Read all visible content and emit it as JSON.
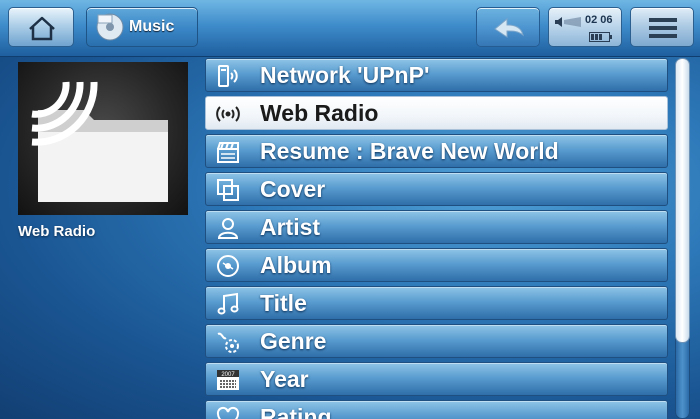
{
  "topbar": {
    "title": "Music",
    "time": "02 06",
    "icons": {
      "home": "home-icon",
      "title": "music-folder-icon",
      "back": "back-arrow-icon",
      "volume": "volume-icon",
      "battery": "battery-icon",
      "menu": "menu-icon"
    }
  },
  "left_panel": {
    "label": "Web Radio",
    "art_icon": "web-radio-folder-icon"
  },
  "list": {
    "selected_index": 1,
    "items": [
      {
        "label": "Network 'UPnP'",
        "icon": "network-upnp-icon"
      },
      {
        "label": "Web Radio",
        "icon": "radio-waves-icon"
      },
      {
        "label": "Resume : Brave New World",
        "icon": "clapperboard-icon"
      },
      {
        "label": "Cover",
        "icon": "cover-icon"
      },
      {
        "label": "Artist",
        "icon": "artist-icon"
      },
      {
        "label": "Album",
        "icon": "album-disc-icon"
      },
      {
        "label": "Title",
        "icon": "music-note-icon"
      },
      {
        "label": "Genre",
        "icon": "genre-icon"
      },
      {
        "label": "Year",
        "icon": "calendar-icon",
        "icon_text": "2007"
      },
      {
        "label": "Rating",
        "icon": "heart-icon"
      }
    ]
  },
  "colors": {
    "background": "#2d78b8",
    "row": "#5a9dd0",
    "selected_row": "#ffffff"
  }
}
